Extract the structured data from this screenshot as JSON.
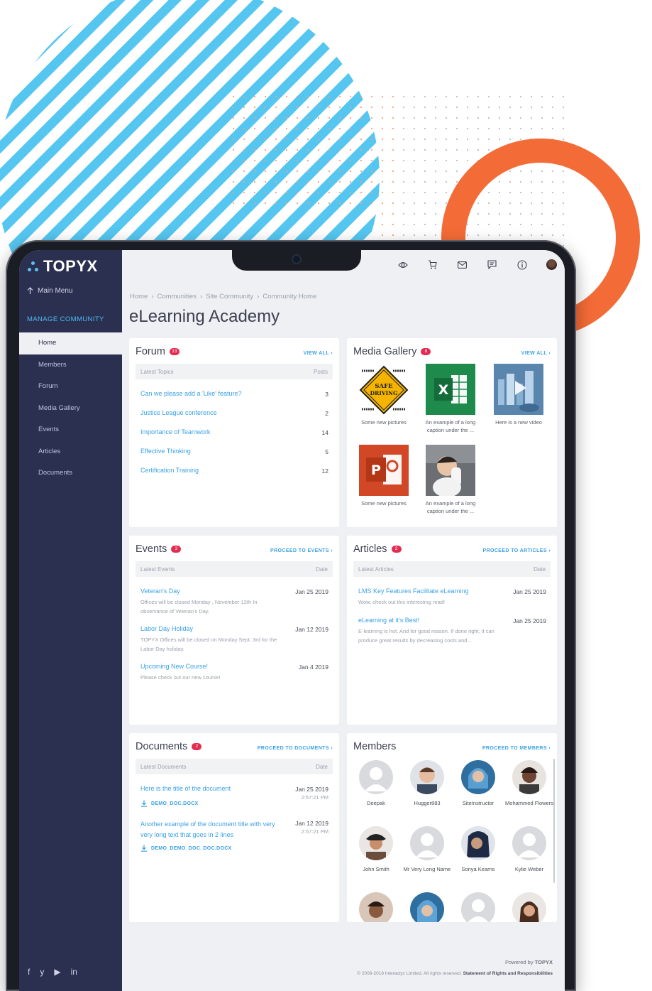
{
  "brand": {
    "name": "TOPYX",
    "accent": "#4fb9f3",
    "sidebar_bg": "#2b3050",
    "badge_color": "#e52b50",
    "link_color": "#3aa1e6"
  },
  "sidebar": {
    "main_menu": "Main Menu",
    "section": "MANAGE COMMUNITY",
    "items": [
      {
        "label": "Home",
        "active": true
      },
      {
        "label": "Members"
      },
      {
        "label": "Forum"
      },
      {
        "label": "Media Gallery"
      },
      {
        "label": "Events"
      },
      {
        "label": "Articles"
      },
      {
        "label": "Documents"
      }
    ],
    "social_icons": [
      "facebook-icon",
      "twitter-icon",
      "youtube-icon",
      "linkedin-icon"
    ],
    "social_glyphs": [
      "f",
      "y",
      "▶",
      "in"
    ]
  },
  "topbar": {
    "icons": [
      "eye-icon",
      "cart-icon",
      "mail-icon",
      "chat-icon",
      "info-icon",
      "user-avatar"
    ]
  },
  "breadcrumb": [
    "Home",
    "Communities",
    "Site Community",
    "Community Home"
  ],
  "page_title": "eLearning Academy",
  "forum": {
    "title": "Forum",
    "badge": "13",
    "link": "VIEW ALL ›",
    "col_topic": "Latest Topics",
    "col_posts": "Posts",
    "rows": [
      {
        "topic": "Can we please add a 'Like' feature?",
        "posts": "3"
      },
      {
        "topic": "Justice League conference",
        "posts": "2"
      },
      {
        "topic": "Importance of Teamwork",
        "posts": "14"
      },
      {
        "topic": "Effective Thinking",
        "posts": "5"
      },
      {
        "topic": "Certification Training",
        "posts": "12"
      }
    ]
  },
  "gallery": {
    "title": "Media Gallery",
    "badge": "8",
    "link": "VIEW ALL ›",
    "items": [
      {
        "caption": "Some new pictures",
        "sign_text": "SAFE DRIVING"
      },
      {
        "caption": "An example of a long caption under the ..."
      },
      {
        "caption": "Here is a new video"
      },
      {
        "caption": "Some new pictures"
      },
      {
        "caption": "An example of a long caption under the ..."
      }
    ]
  },
  "events": {
    "title": "Events",
    "badge": "3",
    "link": "PROCEED TO EVENTS ›",
    "col_name": "Latest Events",
    "col_date": "Date",
    "rows": [
      {
        "name": "Veteran's Day",
        "date": "Jan 25 2019",
        "desc": "Offices will be closed Monday , November 12th In observance of Veteran's Day."
      },
      {
        "name": "Labor Day Holiday",
        "date": "Jan 12 2019",
        "desc": "TOPYX Offices will be closed on Monday Sept. 3rd for the Labor Day holiday."
      },
      {
        "name": "Upcoming New Course!",
        "date": "Jan 4 2019",
        "desc": "Please check out our new course!"
      }
    ]
  },
  "articles": {
    "title": "Articles",
    "badge": "2",
    "link": "PROCEED TO ARTICLES ›",
    "col_name": "Latest Articles",
    "col_date": "Date",
    "rows": [
      {
        "name": "LMS Key Features Facilitate eLearning",
        "date": "Jan 25 2019",
        "desc": "Wow, check out this interesting read!"
      },
      {
        "name": "eLearning at it's Best!",
        "date": "Jan 25 2019",
        "desc": "E-learning is hot. And for good reason. If done right, it can produce great results by decreasing costs and..."
      }
    ]
  },
  "documents": {
    "title": "Documents",
    "badge": "2",
    "link": "PROCEED TO DOCUMENTS ›",
    "col_name": "Latest Documents",
    "col_date": "Date",
    "rows": [
      {
        "name": "Here is the title of the document",
        "date": "Jan 25 2019",
        "time": "2:57:21 PM",
        "file": "DEMO_DOC.DOCX"
      },
      {
        "name": "Another example of the document title with very very long text that goes in 2 lines",
        "date": "Jan 12 2019",
        "time": "2:57:21 PM",
        "file": "DEMO_DEMO_DOC_DOC.DOCX"
      }
    ]
  },
  "members": {
    "title": "Members",
    "link": "PROCEED TO MEMBERS ›",
    "people": [
      {
        "name": "Deepak"
      },
      {
        "name": "Hugger883"
      },
      {
        "name": "SiteInstructor"
      },
      {
        "name": "Mohammed Flowers"
      },
      {
        "name": "John Smith"
      },
      {
        "name": "Mr Very Long Name"
      },
      {
        "name": "Sonya Kearns"
      },
      {
        "name": "Kylie Weber"
      }
    ]
  },
  "footer": {
    "powered_prefix": "Powered by",
    "powered_brand": "TOPYX",
    "copyright": "© 2008-2018 Interactyx Limited. All rights reserved.",
    "statement": "Statement of Rights and Responsibilities"
  }
}
